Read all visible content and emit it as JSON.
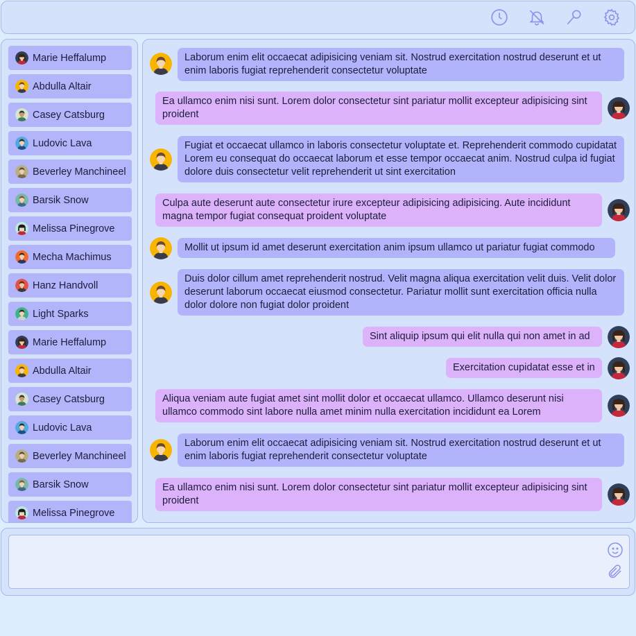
{
  "toolbar": {
    "icons": [
      "clock-icon",
      "bell-off-icon",
      "search-icon",
      "gear-icon"
    ]
  },
  "sidebar": {
    "contacts": [
      {
        "name": "Marie Heffalump",
        "avatar": "dark-hair-woman"
      },
      {
        "name": "Abdulla Altair",
        "avatar": "yellow-man"
      },
      {
        "name": "Casey Catsburg",
        "avatar": "green-person"
      },
      {
        "name": "Ludovic Lava",
        "avatar": "blue-man"
      },
      {
        "name": "Beverley Manchineel",
        "avatar": "khaki-person"
      },
      {
        "name": "Barsik Snow",
        "avatar": "teal-man"
      },
      {
        "name": "Melissa Pinegrove",
        "avatar": "black-hair-woman"
      },
      {
        "name": "Mecha Machimus",
        "avatar": "orange-man"
      },
      {
        "name": "Hanz Handvoll",
        "avatar": "red-man"
      },
      {
        "name": "Light Sparks",
        "avatar": "green-man"
      },
      {
        "name": "Marie Heffalump",
        "avatar": "dark-hair-woman"
      },
      {
        "name": "Abdulla Altair",
        "avatar": "yellow-man"
      },
      {
        "name": "Casey Catsburg",
        "avatar": "green-person"
      },
      {
        "name": "Ludovic Lava",
        "avatar": "blue-man"
      },
      {
        "name": "Beverley Manchineel",
        "avatar": "khaki-person"
      },
      {
        "name": "Barsik Snow",
        "avatar": "teal-man"
      },
      {
        "name": "Melissa Pinegrove",
        "avatar": "black-hair-woman"
      }
    ]
  },
  "chat": {
    "messages": [
      {
        "dir": "in",
        "text": "Laborum enim elit occaecat adipisicing veniam sit. Nostrud exercitation nostrud deserunt et ut enim laboris fugiat reprehenderit consectetur voluptate"
      },
      {
        "dir": "out",
        "text": "Ea ullamco enim nisi sunt. Lorem dolor consectetur sint pariatur mollit excepteur adipisicing sint proident"
      },
      {
        "dir": "in",
        "text": "Fugiat et occaecat ullamco in laboris consectetur voluptate et. Reprehenderit commodo cupidatat Lorem eu consequat do occaecat laborum et esse tempor occaecat anim. Nostrud culpa id fugiat dolore duis consectetur velit reprehenderit ut sint exercitation"
      },
      {
        "dir": "out",
        "text": "Culpa aute deserunt aute consectetur irure excepteur adipisicing adipisicing. Aute incididunt magna tempor fugiat consequat proident voluptate"
      },
      {
        "dir": "in",
        "text": "Mollit ut ipsum id amet deserunt exercitation anim ipsum ullamco ut pariatur fugiat commodo"
      },
      {
        "dir": "in",
        "text": "Duis dolor cillum amet reprehenderit nostrud. Velit magna aliqua exercitation velit duis. Velit dolor deserunt laborum occaecat eiusmod consectetur. Pariatur mollit sunt exercitation officia nulla dolor dolore non fugiat dolor proident"
      },
      {
        "dir": "out",
        "text": "Sint aliquip ipsum qui elit nulla qui non amet in ad"
      },
      {
        "dir": "out",
        "text": "Exercitation cupidatat esse et in"
      },
      {
        "dir": "out",
        "text": "Aliqua veniam aute fugiat amet sint mollit dolor et occaecat ullamco. Ullamco deserunt nisi ullamco commodo sint labore nulla amet minim nulla exercitation incididunt ea Lorem"
      },
      {
        "dir": "in",
        "text": "Laborum enim elit occaecat adipisicing veniam sit. Nostrud exercitation nostrud deserunt et ut enim laboris fugiat reprehenderit consectetur voluptate"
      },
      {
        "dir": "out",
        "text": "Ea ullamco enim nisi sunt. Lorem dolor consectetur sint pariatur mollit excepteur adipisicing sint proident"
      }
    ]
  },
  "composer": {
    "value": "",
    "placeholder": "",
    "icons": [
      "smiley-icon",
      "paperclip-icon"
    ]
  },
  "colors": {
    "panel": "#d4e2fb",
    "border": "#a8b6ea",
    "incoming_bubble": "#b2b4fb",
    "outgoing_bubble": "#dcb3fb",
    "icon": "#8a92e8"
  }
}
